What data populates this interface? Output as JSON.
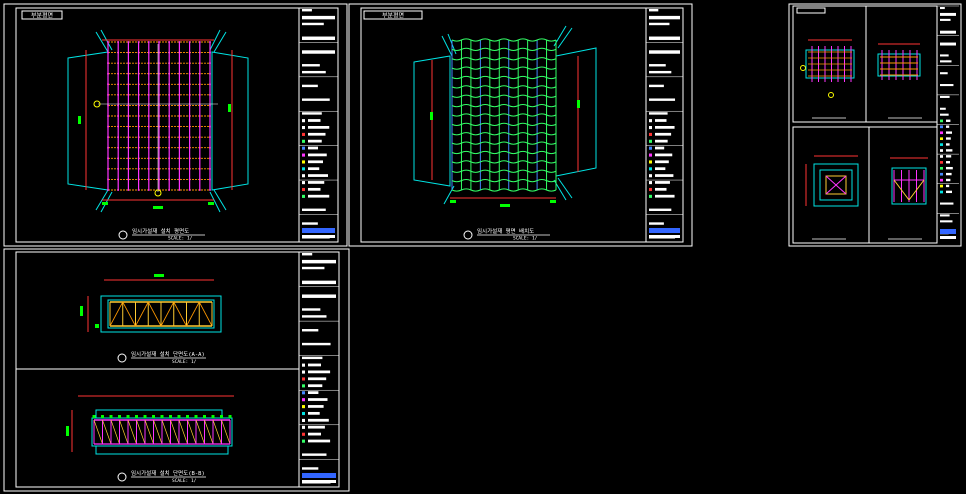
{
  "sheets": {
    "plan_a": {
      "badge": "부분평면",
      "title": "임시가설재 설치 평면도",
      "scale": "SCALE: 1/"
    },
    "plan_b": {
      "badge": "부분평면",
      "title": "임시가설재 평면 배치도",
      "scale": "SCALE: 1/"
    },
    "section_upper": {
      "title": "임시가설재 설치 단면도(A-A)",
      "scale": "SCALE: 1/"
    },
    "section_lower": {
      "title": "임시가설재 설치 단면도(B-B)",
      "scale": "SCALE: 1/"
    }
  },
  "colors": {
    "background": "#000000",
    "frame": "#ffffff",
    "deck": "#00e5e5",
    "grid_magenta": "#ff33ff",
    "grid_orange": "#ff9900",
    "mesh_green": "#33ff66",
    "mesh_blue": "#4488ff",
    "dimension": "#ff3333",
    "label_green": "#00ff00",
    "marker_yellow": "#ffff00",
    "truss_yellow": "#ffcc33"
  }
}
